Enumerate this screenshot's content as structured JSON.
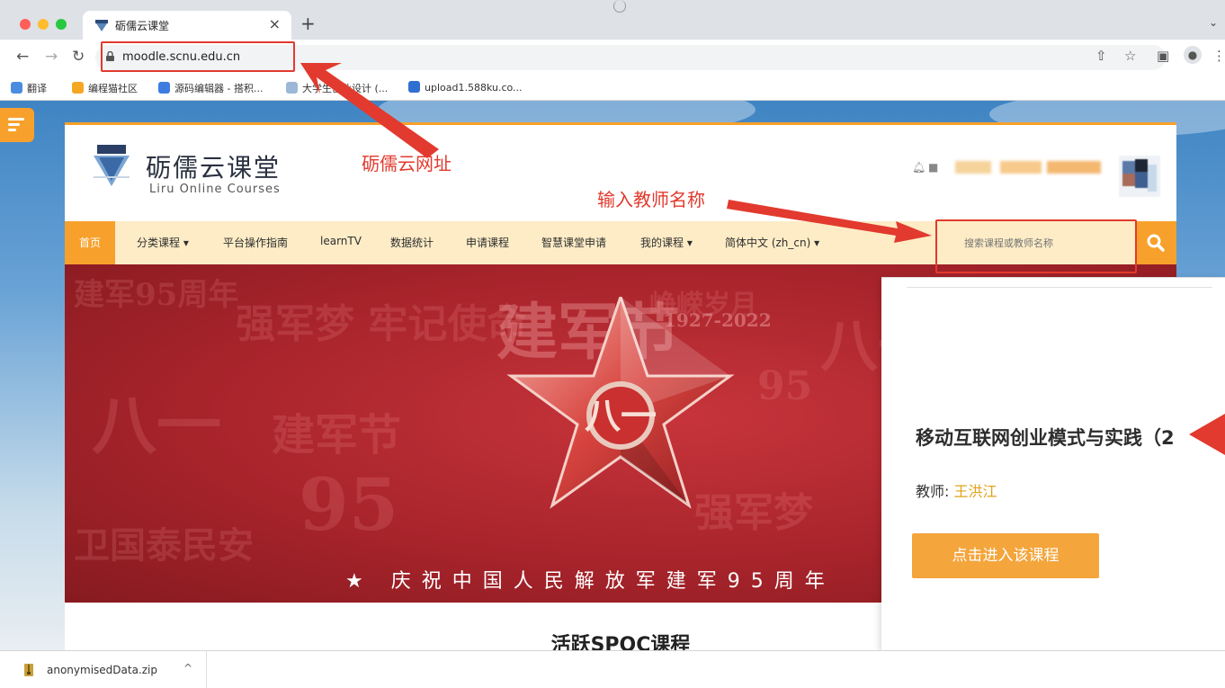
{
  "browser": {
    "tab_title": "砺儒云课堂",
    "tab_close": "×",
    "new_tab": "+",
    "url": "moodle.scnu.edu.cn",
    "bookmarks": [
      "翻译",
      "编程猫社区",
      "源码编辑器 - 搭积...",
      "大学生创业设计 (...",
      "upload1.588ku.co..."
    ]
  },
  "site": {
    "title": "砺儒云课堂",
    "subtitle": "Liru Online Courses"
  },
  "nav": {
    "items": [
      "首页",
      "分类课程 ▾",
      "平台操作指南",
      "learnTV",
      "数据统计",
      "申请课程",
      "智慧课堂申请",
      "我的课程 ▾",
      "简体中文 (zh_cn) ▾"
    ],
    "search_placeholder": "搜索课程或教师名称"
  },
  "banner": {
    "main_text": "建军节",
    "years": "1927-2022",
    "caption": "★ 庆祝中国人民解放军建军95周年"
  },
  "section": {
    "title": "活跃SPOC课程"
  },
  "popup": {
    "course_name": "移动互联网创业模式与实践（2",
    "teacher_label": "教师: ",
    "teacher_name": "王洪江",
    "enter_button": "点击进入该课程"
  },
  "annotations": {
    "url_note": "砺儒云网址",
    "search_note": "输入教师名称"
  },
  "downloads": {
    "file_name": "anonymisedData.zip",
    "chevron": "^"
  },
  "colors": {
    "accent": "#f7a12c",
    "nav_bg": "#fdecc6",
    "annotation_red": "#e23a2e",
    "banner_red": "#b0272e",
    "teacher_gold": "#e2a21a"
  }
}
